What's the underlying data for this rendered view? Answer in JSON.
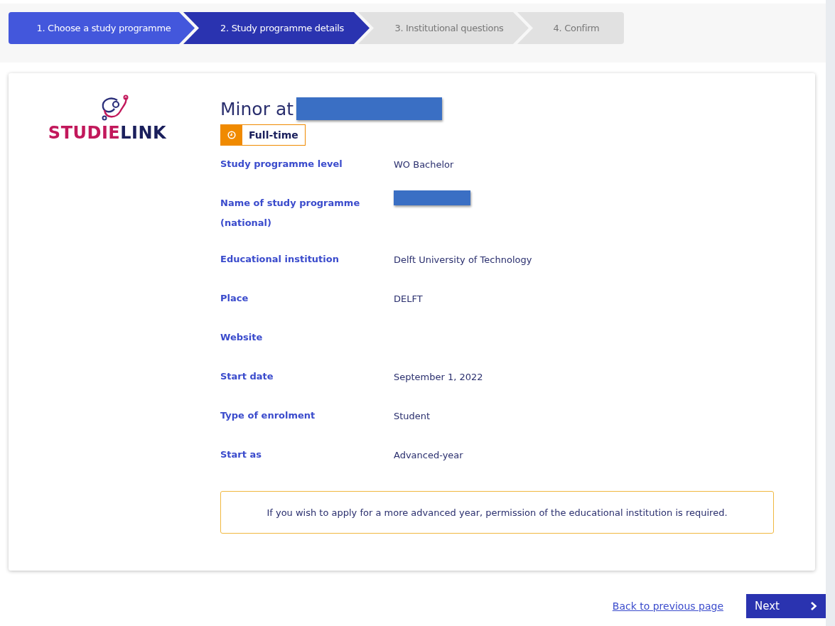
{
  "steps": [
    {
      "label": "1. Choose a study programme",
      "selected": false
    },
    {
      "label": "2. Study programme details",
      "selected": true
    },
    {
      "label": "3. Institutional questions",
      "selected": false
    },
    {
      "label": "4. Confirm",
      "selected": false
    }
  ],
  "logo": {
    "parts": [
      {
        "text": "STUDIE",
        "color": "#c2185b"
      },
      {
        "text": "LINK",
        "color": "#1a1f5c"
      }
    ]
  },
  "programme": {
    "title": "Minor at",
    "title_redacted": true,
    "badge": "Full-time"
  },
  "details": [
    {
      "label": "Study programme level",
      "value": "WO Bachelor"
    },
    {
      "label": "Name of study programme (national)",
      "redacted": true
    },
    {
      "label": "Educational institution",
      "value": "Delft University of Technology"
    },
    {
      "label": "Place",
      "value": "DELFT"
    },
    {
      "label": "Website"
    },
    {
      "label": "Start date",
      "value": "September 1, 2022"
    },
    {
      "label": "Type of enrolment",
      "value": "Student"
    },
    {
      "label": "Start as",
      "value": "Advanced-year"
    }
  ],
  "notice": "If you wish to apply for a more advanced year, permission of the educational institution is required.",
  "footer": {
    "back_link": "Back to previous page",
    "next_button": "Next"
  }
}
